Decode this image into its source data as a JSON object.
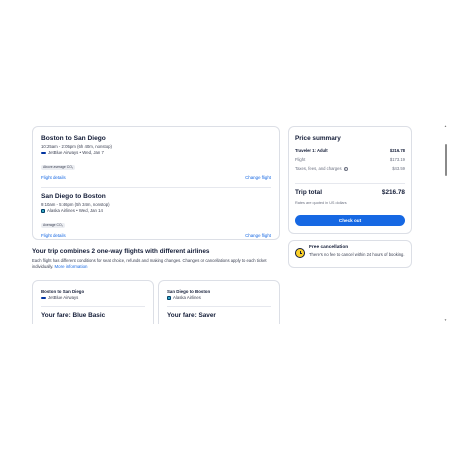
{
  "itinerary": {
    "legs": [
      {
        "route": "Boston to San Diego",
        "times": "10:25am - 2:05pm (6h 40m, nonstop)",
        "airline_date": "JetBlue Airways • Wed, Jan 7",
        "badge": "Above average CO₂",
        "details_label": "Flight details",
        "change_label": "Change flight"
      },
      {
        "route": "San Diego to Boston",
        "times": "9:10am - 5:46pm (5h 34m, nonstop)",
        "airline_date": "Alaska Airlines • Wed, Jan 14",
        "badge": "Average CO₂",
        "details_label": "Flight details",
        "change_label": "Change flight"
      }
    ]
  },
  "combo": {
    "title": "Your trip combines 2 one-way flights with different airlines",
    "description": "Each flight has different conditions for seat choice, refunds and making changes. Changes or cancellations apply to each ticket individually.",
    "more_info": "More information"
  },
  "fares": [
    {
      "route": "Boston to San Diego",
      "airline": "JetBlue Airways",
      "fare": "Your fare: Blue Basic"
    },
    {
      "route": "San Diego to Boston",
      "airline": "Alaska Airlines",
      "fare": "Your fare: Saver"
    }
  ],
  "price_summary": {
    "title": "Price summary",
    "traveler_label": "Traveler 1: Adult",
    "traveler_value": "$216.78",
    "flight_label": "Flight",
    "flight_value": "$173.19",
    "taxes_label": "Taxes, fees, and charges",
    "taxes_value": "$43.59",
    "total_label": "Trip total",
    "total_value": "$216.78",
    "quoted_note": "Rates are quoted in US dollars",
    "checkout_label": "Check out"
  },
  "cancellation": {
    "title": "Free cancellation",
    "description": "There's no fee to cancel within 24 hours of booking."
  },
  "colors": {
    "accent": "#1668e3",
    "text_dark": "#141d38",
    "border": "#dcdfe6",
    "clock_yellow": "#fcd12a"
  }
}
